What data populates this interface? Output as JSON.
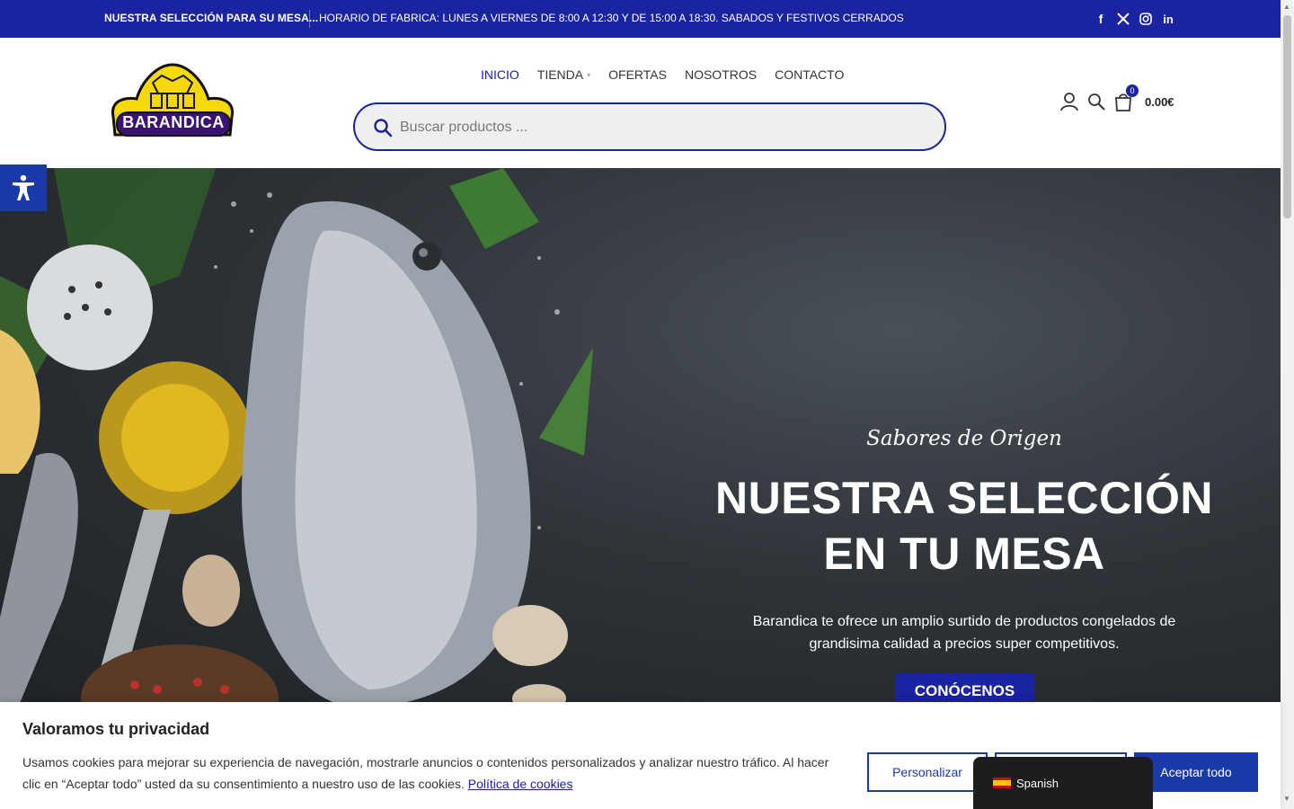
{
  "topbar": {
    "promo": "NUESTRA SELECCIÓN PARA SU MESA...",
    "hours": "HORARIO DE FABRICA: LUNES A VIERNES DE 8:00 A 12:30 Y DE 15:00  A 18:30. SABADOS Y FESTIVOS CERRADOS",
    "social": [
      "facebook-icon",
      "x-icon",
      "instagram-icon",
      "linkedin-icon"
    ]
  },
  "header": {
    "logo_text": "BARANDICA",
    "nav": [
      {
        "label": "INICIO",
        "active": true
      },
      {
        "label": "TIENDA",
        "active": false
      },
      {
        "label": "OFERTAS",
        "active": false
      },
      {
        "label": "NOSOTROS",
        "active": false
      },
      {
        "label": "CONTACTO",
        "active": false
      }
    ],
    "search_placeholder": "Buscar productos ...",
    "cart_count": "0",
    "cart_total": "0.00€"
  },
  "hero": {
    "subtitle": "Sabores de Origen",
    "title_line1": "NUESTRA SELECCIÓN",
    "title_line2": "EN TU MESA",
    "desc_line1": "Barandica te ofrece un amplio surtido de productos congelados de",
    "desc_line2": "grandisima calidad a precios super competitivos.",
    "cta": "CONÓCENOS"
  },
  "cookie": {
    "title": "Valoramos tu privacidad",
    "text": "Usamos cookies para mejorar su experiencia de navegación, mostrarle anuncios o contenidos personalizados y analizar nuestro tráfico. Al hacer clic en “Aceptar todo” usted da su consentimiento a nuestro uso de las cookies.",
    "link": "Política de cookies",
    "btn_customize": "Personalizar",
    "btn_accept": "Aceptar todo"
  },
  "language": {
    "label": "Spanish"
  },
  "colors": {
    "brand_blue": "#1a23a0",
    "logo_yellow": "#f5d90a"
  }
}
